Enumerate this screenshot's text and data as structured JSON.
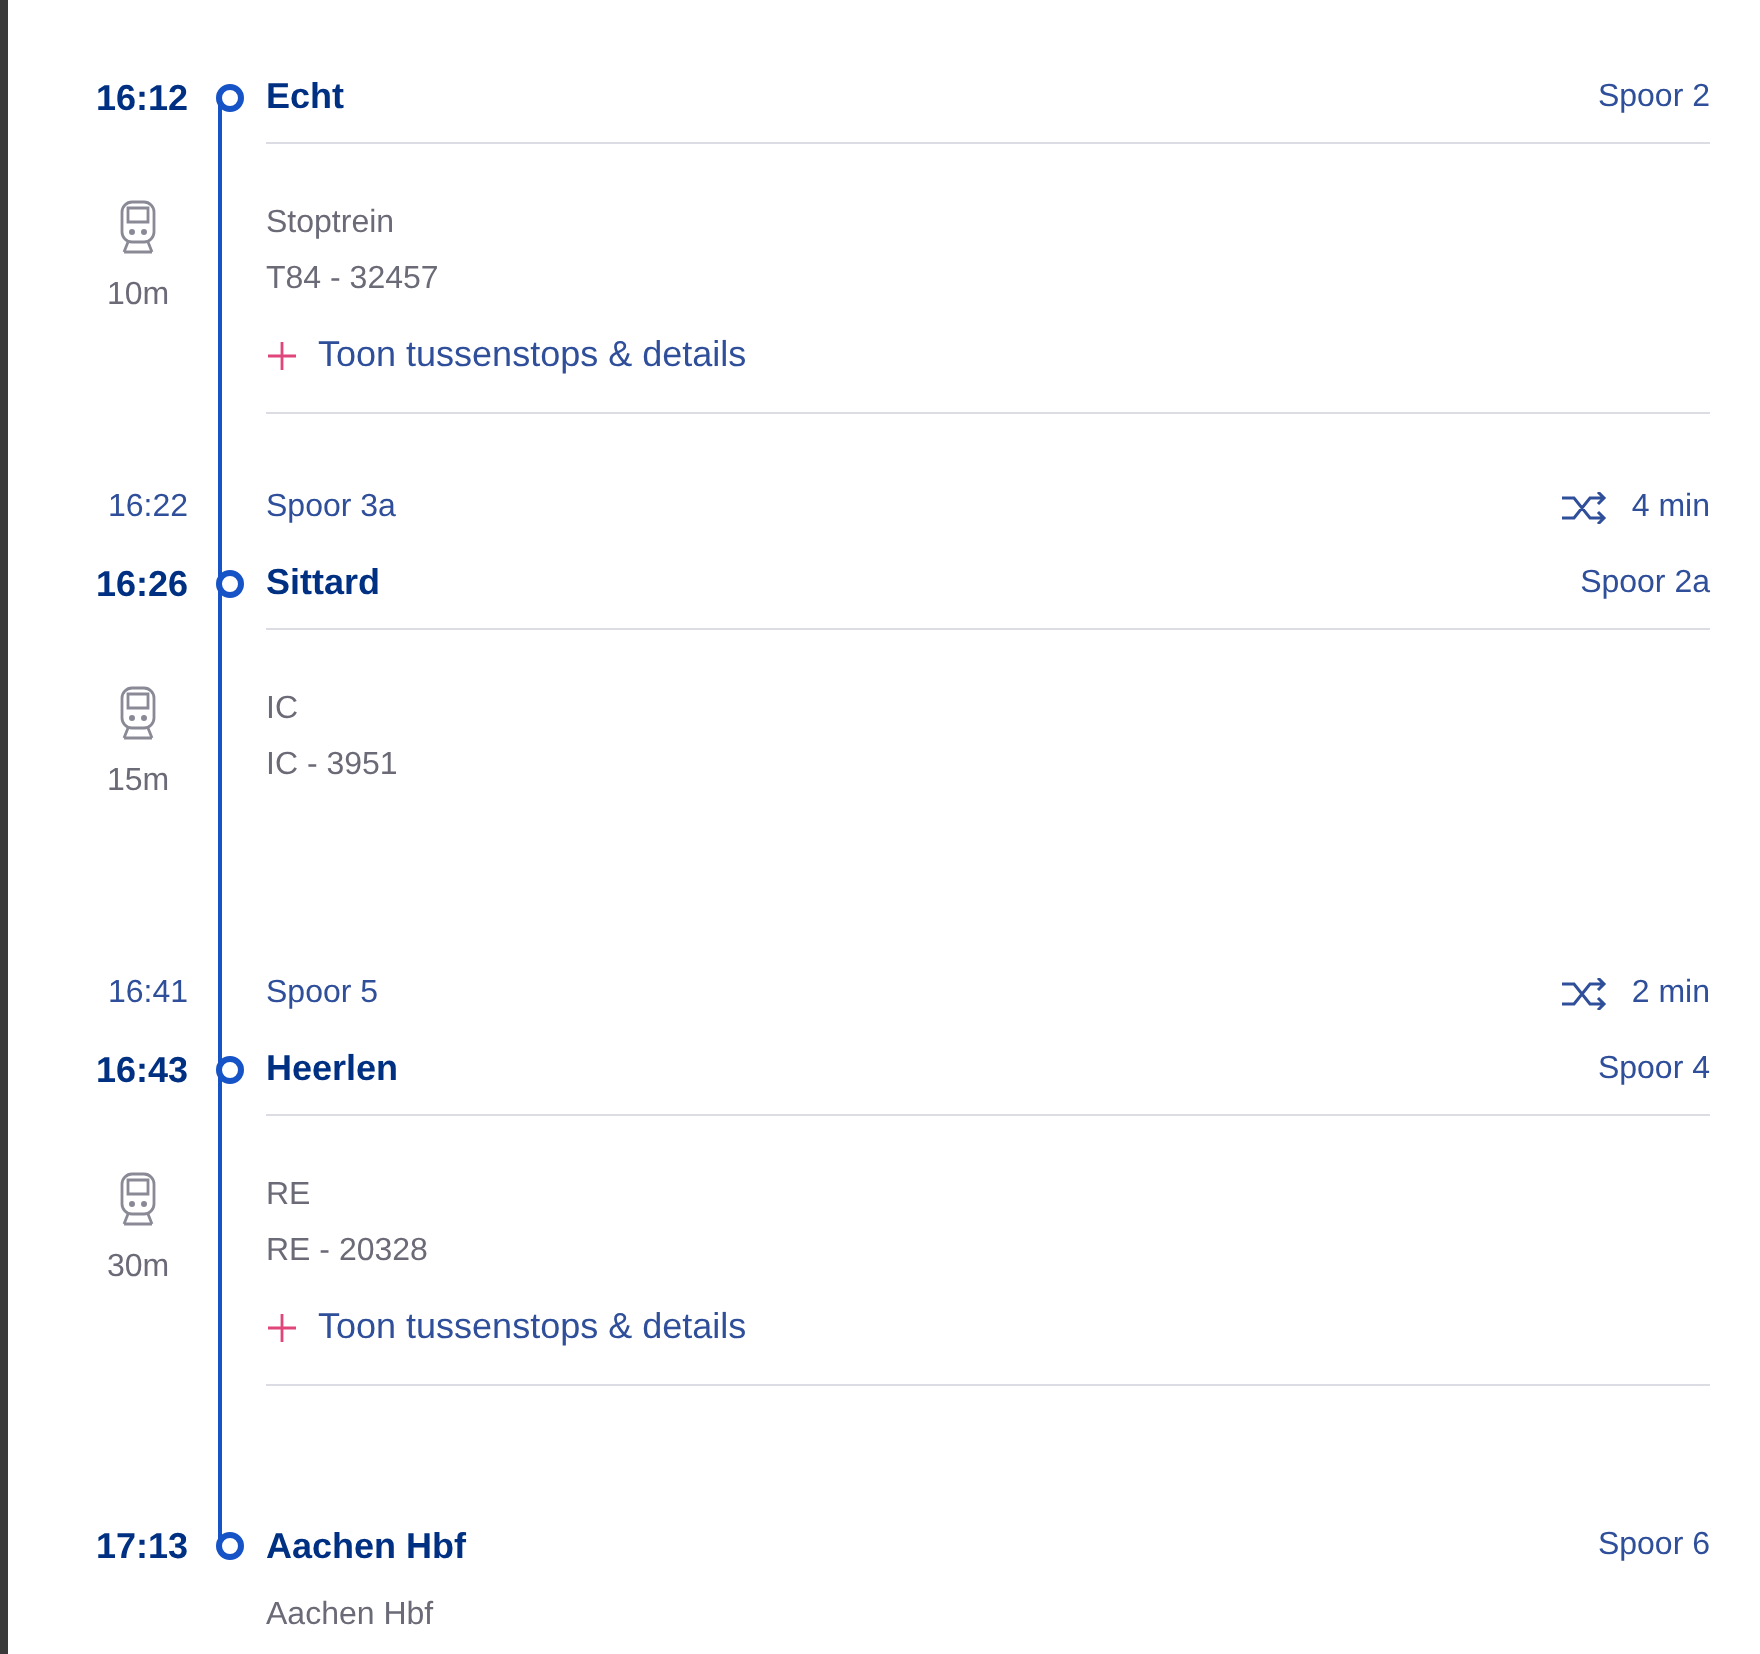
{
  "legs": [
    {
      "departure": {
        "time": "16:12",
        "station": "Echt",
        "platform": "Spoor 2"
      },
      "duration": "10m",
      "service": "Stoptrein",
      "train": "T84 - 32457",
      "details_link": "Toon tussenstops & details",
      "arrival": {
        "time": "16:22",
        "platform": "Spoor 3a",
        "transfer": "4 min"
      }
    },
    {
      "departure": {
        "time": "16:26",
        "station": "Sittard",
        "platform": "Spoor 2a"
      },
      "duration": "15m",
      "service": "IC",
      "train": "IC - 3951",
      "arrival": {
        "time": "16:41",
        "platform": "Spoor 5",
        "transfer": "2 min"
      }
    },
    {
      "departure": {
        "time": "16:43",
        "station": "Heerlen",
        "platform": "Spoor 4"
      },
      "duration": "30m",
      "service": "RE",
      "train": "RE - 20328",
      "details_link": "Toon tussenstops & details"
    }
  ],
  "destination": {
    "time": "17:13",
    "station": "Aachen Hbf",
    "platform": "Spoor 6",
    "subtitle": "Aachen Hbf"
  }
}
